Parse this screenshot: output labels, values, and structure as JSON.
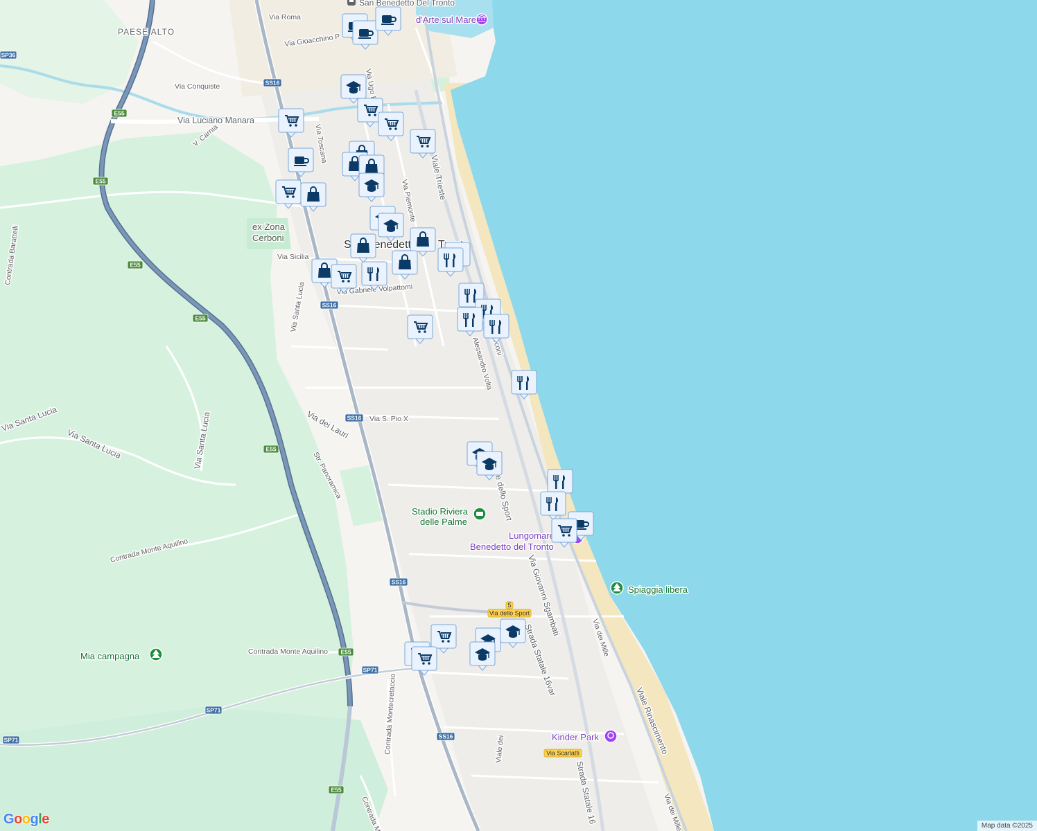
{
  "map": {
    "city_top": "San Benedetto Del Tronto",
    "city_center": "San Benedetto del Tronto",
    "district": "PAESE ALTO",
    "attribution": "Map data ©2025",
    "logo": "Google",
    "colors": {
      "sea": "#8ed8ec",
      "land": "#f5f4f1",
      "green": "#d6f2df",
      "beach": "#f4e6bf",
      "highway": "#7a96b8",
      "marker_fill": "#eaf3fd",
      "marker_glyph": "#0b3a66"
    }
  },
  "road_labels": [
    "Via Roma",
    "Via Gioacchino P",
    "Via Conquiste",
    "Via Luciano Manara",
    "V. Carnia",
    "Via Toscana",
    "Via Ugo Ba",
    "Viale Trieste",
    "Via Piemonte",
    "Via Sicilia",
    "Via Gabriele Volpattomi",
    "Via Santa Lucia",
    "Contrada Barattelli",
    "Via Santa Lucia",
    "Via Santa Lucia",
    "Via Santa Lucia",
    "Via dei Lauri",
    "Via S. Pio X",
    "Str. Panoramica",
    "Contrada Monte Aquilino",
    "Contrada Monte Aquilino",
    "Contrada Montecretaccio",
    "Contrada Mon",
    "Via Giovanni Sgambati",
    "Strada Statale 16var",
    "Strada Statale 16",
    "Via dei Mille",
    "Viale Rinascimento",
    "Via dei Mille",
    "Alessandro Volta",
    "Marconi",
    "Viale dello Sport",
    "Viale dei"
  ],
  "place_labels": {
    "ex_zona": "ex Zona",
    "cerboni": "Cerboni",
    "stadio_line1": "Stadio Riviera",
    "stadio_line2": "delle Palme",
    "lungomare_line1": "Lungomare",
    "lungomare_line2": "Benedetto del Tronto",
    "spiaggia": "Spiaggia libera",
    "kinder": "Kinder Park",
    "campagna": "Mia campagna",
    "arte": "d'Arte sul Mare"
  },
  "shields": [
    "SP36",
    "E55",
    "E55",
    "E55",
    "E55",
    "E55",
    "E55",
    "E55",
    "SS16",
    "SS16",
    "SS16",
    "SS16",
    "SS16",
    "SP71",
    "SP71",
    "SP71"
  ],
  "yellow_signs": [
    "Via dello Sport",
    "Via Scarlatti",
    "5"
  ],
  "markers": [
    "coffee",
    "coffee",
    "coffee",
    "school",
    "cart",
    "cart",
    "cart",
    "cart",
    "coffee",
    "bag",
    "bag",
    "bag",
    "cart",
    "bag",
    "school",
    "school",
    "school",
    "bag",
    "bag",
    "bag",
    "cart",
    "cart",
    "restaurant",
    "restaurant",
    "restaurant",
    "restaurant",
    "restaurant",
    "restaurant",
    "restaurant",
    "bag",
    "restaurant",
    "school",
    "school",
    "restaurant",
    "restaurant",
    "coffee",
    "cart",
    "cart",
    "school",
    "school",
    "cart",
    "cart",
    "school"
  ]
}
